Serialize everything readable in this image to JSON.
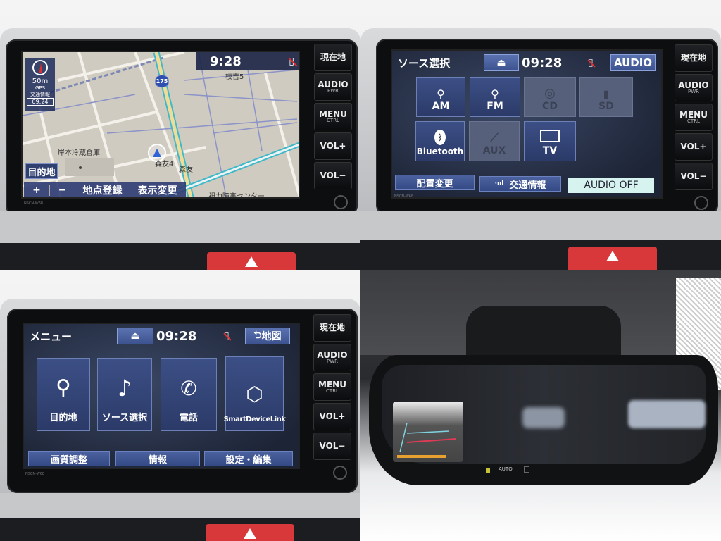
{
  "side_buttons": [
    {
      "label": "現在地",
      "sub": ""
    },
    {
      "label": "AUDIO",
      "sub": "PWR"
    },
    {
      "label": "MENU",
      "sub": "CTRL"
    },
    {
      "label": "VOL+",
      "sub": ""
    },
    {
      "label": "VOL−",
      "sub": ""
    }
  ],
  "model": "NSCN-W68",
  "map_screen": {
    "clock": "9:28",
    "scale": "50m",
    "gps": "GPS",
    "traffic_label": "交通情報",
    "traffic_time": "09:24",
    "route_number": "175",
    "labels": [
      "枝吉5",
      "岸本冷蔵倉庫",
      "森友4",
      "森友",
      "視力障害センター"
    ],
    "destination_button": "目的地",
    "zoom_in": "+",
    "zoom_out": "−",
    "register_point": "地点登録",
    "change_view": "表示変更"
  },
  "source_screen": {
    "title": "ソース選択",
    "eject": "⏏",
    "clock": "09:28",
    "audio_button": "AUDIO",
    "sources": [
      {
        "label": "AM",
        "icon": "radio-tower-icon",
        "enabled": true
      },
      {
        "label": "FM",
        "icon": "radio-tower-icon",
        "enabled": true
      },
      {
        "label": "CD",
        "icon": "disc-icon",
        "enabled": false
      },
      {
        "label": "SD",
        "icon": "sd-card-icon",
        "enabled": false
      },
      {
        "label": "Bluetooth",
        "icon": "bluetooth-icon",
        "enabled": true
      },
      {
        "label": "AUX",
        "icon": "aux-cable-icon",
        "enabled": false
      },
      {
        "label": "TV",
        "icon": "tv-icon",
        "enabled": true
      }
    ],
    "rearrange": "配置変更",
    "traffic_info": "交通情報",
    "audio_off": "AUDIO OFF"
  },
  "menu_screen": {
    "title": "メニュー",
    "eject": "⏏",
    "clock": "09:28",
    "back_map": "地図",
    "items": [
      {
        "label": "目的地",
        "icon": "map-pin-icon"
      },
      {
        "label": "ソース選択",
        "icon": "music-note-icon"
      },
      {
        "label": "電話",
        "icon": "phone-icon"
      },
      {
        "label": "SmartDeviceLink",
        "icon": "smartdevicelink-icon"
      }
    ],
    "picture_adjust": "画質調整",
    "info": "情報",
    "settings": "設定・編集"
  },
  "mirror": {
    "auto_label": "AUTO"
  },
  "colors": {
    "button_blue": "#3d5390",
    "screen_dark": "#1d2436",
    "map_bg": "#cfcbc0",
    "hazard_red": "#d9383a",
    "audio_off_bg": "#d6f3f0"
  }
}
